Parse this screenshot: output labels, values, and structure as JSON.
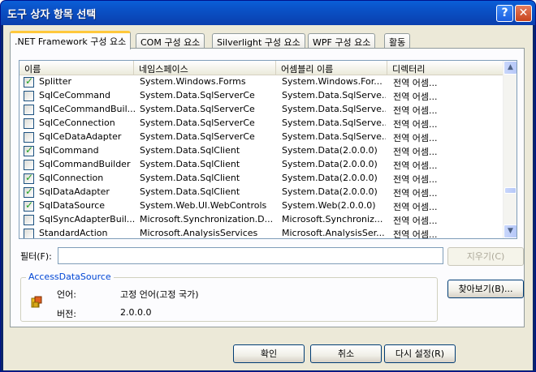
{
  "window": {
    "title": "도구 상자 항목 선택",
    "help_label": "?",
    "close_label": "✕"
  },
  "tabs": [
    {
      "label": ".NET Framework 구성 요소",
      "active": true
    },
    {
      "label": "COM 구성 요소",
      "active": false
    },
    {
      "label": "Silverlight 구성 요소",
      "active": false
    },
    {
      "label": "WPF 구성 요소",
      "active": false
    },
    {
      "label": "활동",
      "active": false
    }
  ],
  "list": {
    "columns": [
      "이름",
      "네임스페이스",
      "어셈블리 이름",
      "디렉터리"
    ],
    "rows": [
      {
        "checked": true,
        "name": "Splitter",
        "namespace": "System.Windows.Forms",
        "assembly": "System.Windows.For...",
        "directory": "전역 어셈..."
      },
      {
        "checked": false,
        "name": "SqlCeCommand",
        "namespace": "System.Data.SqlServerCe",
        "assembly": "System.Data.SqlServe...",
        "directory": "전역 어셈..."
      },
      {
        "checked": false,
        "name": "SqlCeCommandBuil...",
        "namespace": "System.Data.SqlServerCe",
        "assembly": "System.Data.SqlServe...",
        "directory": "전역 어셈..."
      },
      {
        "checked": false,
        "name": "SqlCeConnection",
        "namespace": "System.Data.SqlServerCe",
        "assembly": "System.Data.SqlServe...",
        "directory": "전역 어셈..."
      },
      {
        "checked": false,
        "name": "SqlCeDataAdapter",
        "namespace": "System.Data.SqlServerCe",
        "assembly": "System.Data.SqlServe...",
        "directory": "전역 어셈..."
      },
      {
        "checked": true,
        "name": "SqlCommand",
        "namespace": "System.Data.SqlClient",
        "assembly": "System.Data(2.0.0.0)",
        "directory": "전역 어셈..."
      },
      {
        "checked": false,
        "name": "SqlCommandBuilder",
        "namespace": "System.Data.SqlClient",
        "assembly": "System.Data(2.0.0.0)",
        "directory": "전역 어셈..."
      },
      {
        "checked": true,
        "name": "SqlConnection",
        "namespace": "System.Data.SqlClient",
        "assembly": "System.Data(2.0.0.0)",
        "directory": "전역 어셈..."
      },
      {
        "checked": true,
        "name": "SqlDataAdapter",
        "namespace": "System.Data.SqlClient",
        "assembly": "System.Data(2.0.0.0)",
        "directory": "전역 어셈..."
      },
      {
        "checked": true,
        "name": "SqlDataSource",
        "namespace": "System.Web.UI.WebControls",
        "assembly": "System.Web(2.0.0.0)",
        "directory": "전역 어셈..."
      },
      {
        "checked": false,
        "name": "SqlSyncAdapterBuil...",
        "namespace": "Microsoft.Synchronization.D...",
        "assembly": "Microsoft.Synchroniz...",
        "directory": "전역 어셈..."
      },
      {
        "checked": false,
        "name": "StandardAction",
        "namespace": "Microsoft.AnalysisServices",
        "assembly": "Microsoft.AnalysisSer...",
        "directory": "전역 어셈..."
      }
    ]
  },
  "filter": {
    "label": "필터(F):",
    "value": "",
    "clear_label": "지우기(C)"
  },
  "details": {
    "group_title": "AccessDataSource",
    "language_label": "언어:",
    "language_value": "고정 언어(고정 국가)",
    "version_label": "버전:",
    "version_value": "2.0.0.0",
    "browse_label": "찾아보기(B)..."
  },
  "footer": {
    "ok_label": "확인",
    "cancel_label": "취소",
    "reset_label": "다시 설정(R)"
  }
}
